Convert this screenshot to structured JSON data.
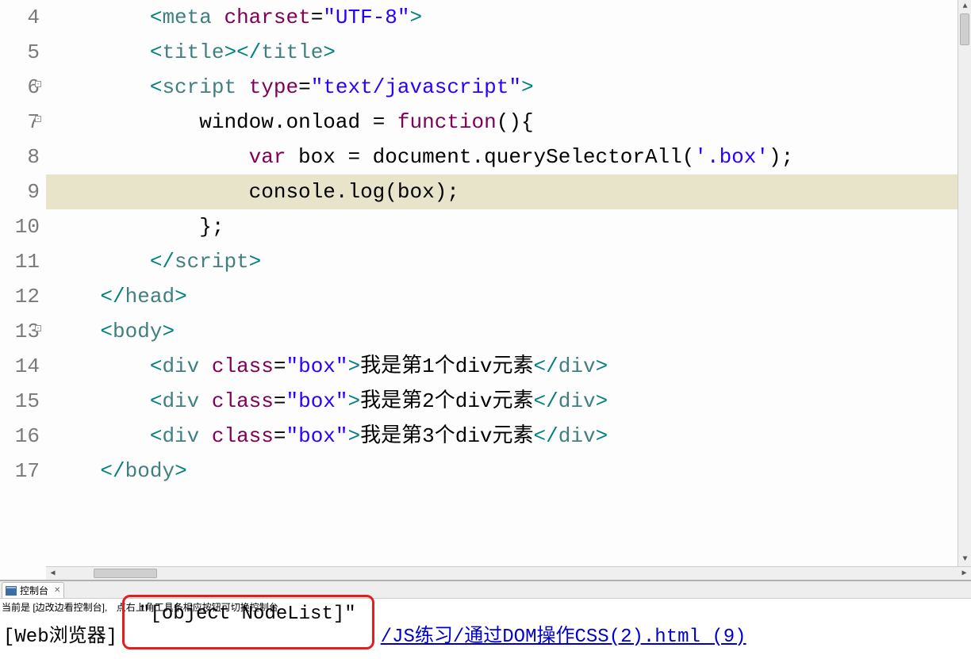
{
  "editor": {
    "line_numbers": [
      "4",
      "5",
      "6",
      "7",
      "8",
      "9",
      "10",
      "11",
      "12",
      "13",
      "14",
      "15",
      "16",
      "17"
    ],
    "fold_lines": [
      "6",
      "7",
      "13"
    ],
    "highlighted_line": 9,
    "lines": {
      "4": {
        "indent": "        ",
        "tokens": [
          [
            "<",
            "t-punct"
          ],
          [
            "meta",
            "t-tag"
          ],
          [
            " ",
            ""
          ],
          [
            "charset",
            "t-attr"
          ],
          [
            "=",
            "t-op"
          ],
          [
            "\"UTF-8\"",
            "t-str"
          ],
          [
            ">",
            "t-punct"
          ]
        ]
      },
      "5": {
        "indent": "        ",
        "tokens": [
          [
            "<",
            "t-punct"
          ],
          [
            "title",
            "t-tag"
          ],
          [
            ">",
            "t-punct"
          ],
          [
            "</",
            "t-punct"
          ],
          [
            "title",
            "t-tag"
          ],
          [
            ">",
            "t-punct"
          ]
        ]
      },
      "6": {
        "indent": "        ",
        "tokens": [
          [
            "<",
            "t-punct"
          ],
          [
            "script",
            "t-tag"
          ],
          [
            " ",
            ""
          ],
          [
            "type",
            "t-attr"
          ],
          [
            "=",
            "t-op"
          ],
          [
            "\"text/javascript\"",
            "t-str"
          ],
          [
            ">",
            "t-punct"
          ]
        ]
      },
      "7": {
        "indent": "            ",
        "tokens": [
          [
            "window",
            "t-txt"
          ],
          [
            ".",
            "t-op"
          ],
          [
            "onload",
            "t-txt"
          ],
          [
            " = ",
            "t-op"
          ],
          [
            "function",
            "t-kw"
          ],
          [
            "(){",
            "t-txt"
          ]
        ]
      },
      "8": {
        "indent": "                ",
        "tokens": [
          [
            "var",
            "t-kw"
          ],
          [
            " box = ",
            "t-txt"
          ],
          [
            "document",
            "t-txt"
          ],
          [
            ".",
            "t-op"
          ],
          [
            "querySelectorAll",
            "t-txt"
          ],
          [
            "(",
            "t-txt"
          ],
          [
            "'.box'",
            "t-str"
          ],
          [
            ");",
            "t-txt"
          ]
        ]
      },
      "9": {
        "indent": "                ",
        "tokens": [
          [
            "console",
            "t-txt"
          ],
          [
            ".",
            "t-op"
          ],
          [
            "log",
            "t-txt"
          ],
          [
            "(box);",
            "t-txt"
          ]
        ]
      },
      "10": {
        "indent": "            ",
        "tokens": [
          [
            "};",
            "t-txt"
          ]
        ]
      },
      "11": {
        "indent": "        ",
        "tokens": [
          [
            "</",
            "t-punct"
          ],
          [
            "script",
            "t-tag"
          ],
          [
            ">",
            "t-punct"
          ]
        ]
      },
      "12": {
        "indent": "    ",
        "tokens": [
          [
            "</",
            "t-punct"
          ],
          [
            "head",
            "t-tag"
          ],
          [
            ">",
            "t-punct"
          ]
        ]
      },
      "13": {
        "indent": "    ",
        "tokens": [
          [
            "<",
            "t-punct"
          ],
          [
            "body",
            "t-tag"
          ],
          [
            ">",
            "t-punct"
          ]
        ]
      },
      "14": {
        "indent": "        ",
        "tokens": [
          [
            "<",
            "t-punct"
          ],
          [
            "div",
            "t-tag"
          ],
          [
            " ",
            ""
          ],
          [
            "class",
            "t-attr"
          ],
          [
            "=",
            "t-op"
          ],
          [
            "\"box\"",
            "t-str"
          ],
          [
            ">",
            "t-punct"
          ],
          [
            "我是第1个div元素",
            "t-txt"
          ],
          [
            "</",
            "t-punct"
          ],
          [
            "div",
            "t-tag"
          ],
          [
            ">",
            "t-punct"
          ]
        ]
      },
      "15": {
        "indent": "        ",
        "tokens": [
          [
            "<",
            "t-punct"
          ],
          [
            "div",
            "t-tag"
          ],
          [
            " ",
            ""
          ],
          [
            "class",
            "t-attr"
          ],
          [
            "=",
            "t-op"
          ],
          [
            "\"box\"",
            "t-str"
          ],
          [
            ">",
            "t-punct"
          ],
          [
            "我是第2个div元素",
            "t-txt"
          ],
          [
            "</",
            "t-punct"
          ],
          [
            "div",
            "t-tag"
          ],
          [
            ">",
            "t-punct"
          ]
        ]
      },
      "16": {
        "indent": "        ",
        "tokens": [
          [
            "<",
            "t-punct"
          ],
          [
            "div",
            "t-tag"
          ],
          [
            " ",
            ""
          ],
          [
            "class",
            "t-attr"
          ],
          [
            "=",
            "t-op"
          ],
          [
            "\"box\"",
            "t-str"
          ],
          [
            ">",
            "t-punct"
          ],
          [
            "我是第3个div元素",
            "t-txt"
          ],
          [
            "</",
            "t-punct"
          ],
          [
            "div",
            "t-tag"
          ],
          [
            ">",
            "t-punct"
          ]
        ]
      },
      "17": {
        "indent": "    ",
        "tokens": [
          [
            "</",
            "t-punct"
          ],
          [
            "body",
            "t-tag"
          ],
          [
            ">",
            "t-punct"
          ]
        ]
      }
    }
  },
  "console": {
    "tab_label": "控制台",
    "info_prefix": "当前是 [边改边看控制台],",
    "info_hint": "点右上角工具条相应按钮可切换控制台",
    "log_source_label": "[Web浏览器]",
    "log_value": "\"[object NodeList]\"",
    "log_link": "/JS练习/通过DOM操作CSS(2).html (9)"
  }
}
